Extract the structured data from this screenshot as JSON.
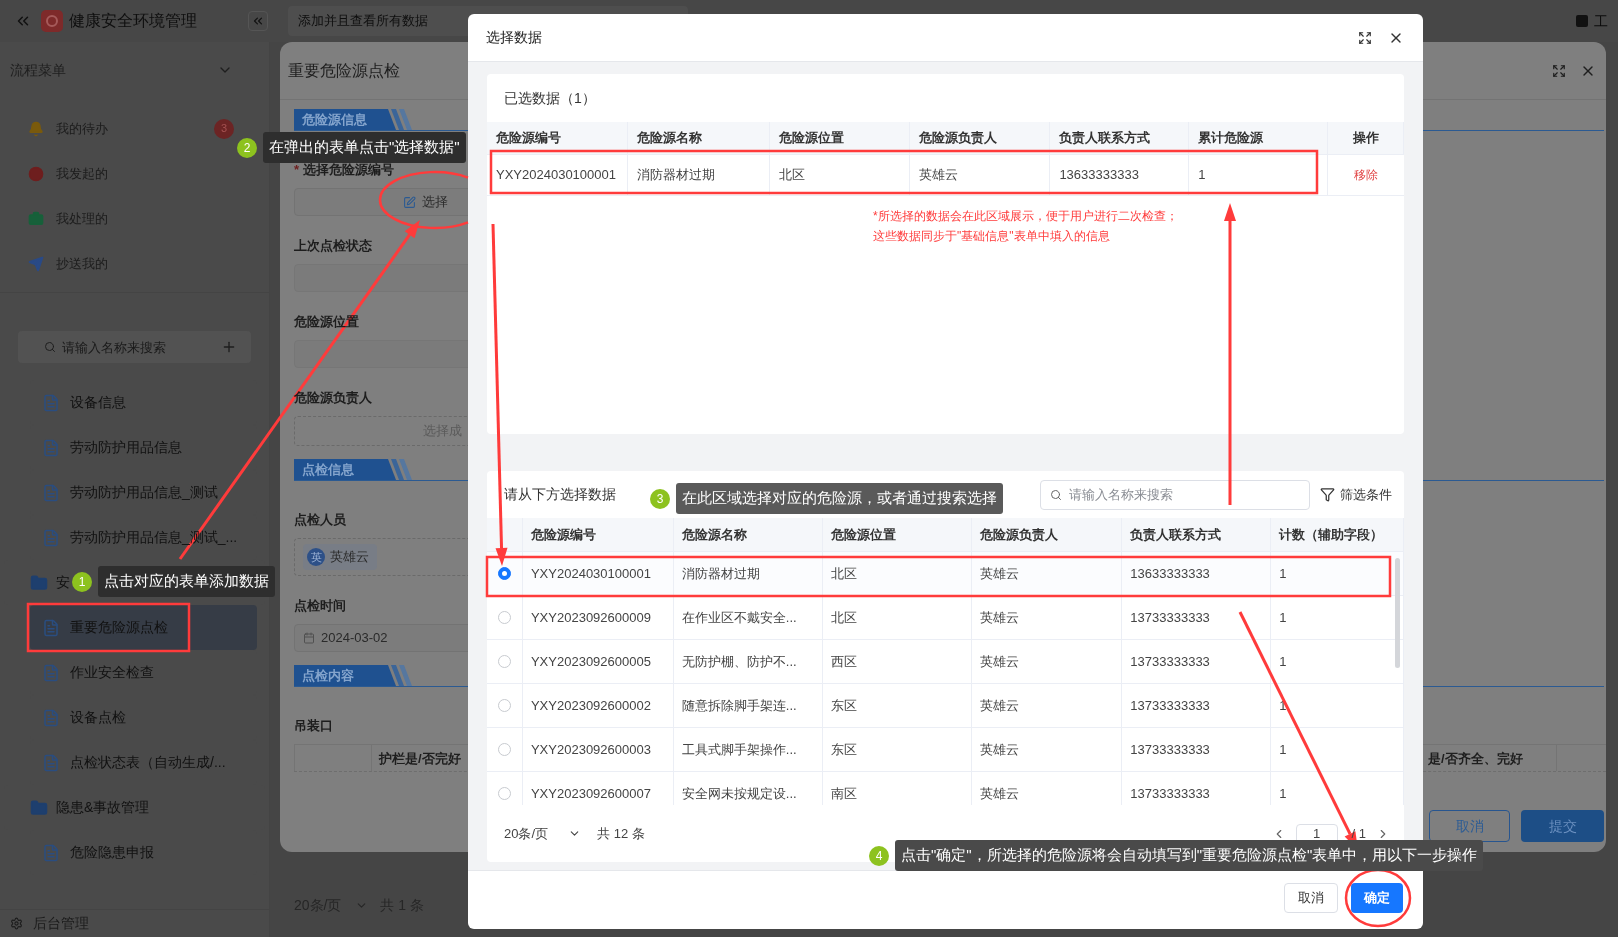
{
  "app": {
    "title": "健康安全环境管理",
    "tab": "添加并且查看所有数据",
    "top_right": "工"
  },
  "sidebar": {
    "section": "流程菜单",
    "quick_items": [
      {
        "label": "我的待办",
        "kind": "todo",
        "badge": "3"
      },
      {
        "label": "我发起的",
        "kind": "started"
      },
      {
        "label": "我处理的",
        "kind": "handled"
      },
      {
        "label": "抄送我的",
        "kind": "cc"
      }
    ],
    "search": {
      "placeholder": "请输入名称来搜索"
    },
    "tree": [
      {
        "label": "设备信息",
        "kind": "form",
        "selected": false
      },
      {
        "label": "劳动防护用品信息",
        "kind": "form",
        "selected": false
      },
      {
        "label": "劳动防护用品信息_测试",
        "kind": "form",
        "selected": false
      },
      {
        "label": "劳动防护用品信息_测试_...",
        "kind": "form",
        "selected": false
      },
      {
        "label": "安",
        "kind": "folder",
        "selected": false,
        "children": [
          {
            "label": "重要危险源点检",
            "kind": "form",
            "selected": true
          },
          {
            "label": "作业安全检查",
            "kind": "form",
            "selected": false
          },
          {
            "label": "设备点检",
            "kind": "form",
            "selected": false
          },
          {
            "label": "点检状态表（自动生成/...",
            "kind": "form",
            "selected": false
          }
        ]
      },
      {
        "label": "隐患&事故管理",
        "kind": "folder",
        "selected": false,
        "children": [
          {
            "label": "危险隐患申报",
            "kind": "form",
            "selected": false
          }
        ]
      }
    ],
    "footer": "后台管理"
  },
  "background_pagination": {
    "page_size": "20条/页",
    "total": "共 1 条"
  },
  "form_drawer": {
    "title": "重要危险源点检",
    "required_mark": "*",
    "sections": [
      {
        "title": "危险源信息",
        "fields": [
          {
            "label": "选择危险源编号",
            "required": true,
            "kind": "picker",
            "button": "选择"
          },
          {
            "label": "上次点检状态",
            "required": false,
            "kind": "input"
          },
          {
            "label": "危险源位置",
            "required": false,
            "kind": "input"
          },
          {
            "label": "危险源负责人",
            "required": false,
            "kind": "auto",
            "hint": "选择成"
          }
        ]
      },
      {
        "title": "点检信息",
        "fields": [
          {
            "label": "点检人员",
            "required": false,
            "kind": "user",
            "avatar": "英",
            "tag": "英雄云"
          },
          {
            "label": "点检时间",
            "required": false,
            "kind": "date",
            "value": "2024-03-02"
          }
        ]
      },
      {
        "title": "点检内容",
        "fields": [
          {
            "label": "吊装口",
            "required": false,
            "kind": "table",
            "columns": [
              "护栏是/否完好",
              "是/否齐全、完好"
            ]
          }
        ]
      }
    ],
    "buttons": {
      "cancel": "取消",
      "submit": "提交"
    }
  },
  "dialog": {
    "title": "选择数据",
    "selected_panel": {
      "title": "已选数据（1）",
      "columns": [
        "危险源编号",
        "危险源名称",
        "危险源位置",
        "危险源负责人",
        "负责人联系方式",
        "累计危险源",
        "操作"
      ],
      "rows": [
        {
          "cells": [
            "YXY2024030100001",
            "消防器材过期",
            "北区",
            "英雄云",
            "13633333333",
            "1"
          ],
          "action": "移除"
        }
      ]
    },
    "source_panel": {
      "title": "请从下方选择数据",
      "search": {
        "placeholder": "请输入名称来搜索"
      },
      "filter": "筛选条件",
      "columns": [
        "危险源编号",
        "危险源名称",
        "危险源位置",
        "危险源负责人",
        "负责人联系方式",
        "计数（辅助字段）"
      ],
      "rows": [
        {
          "selected": true,
          "cells": [
            "YXY2024030100001",
            "消防器材过期",
            "北区",
            "英雄云",
            "13633333333",
            "1"
          ]
        },
        {
          "selected": false,
          "cells": [
            "YXY2023092600009",
            "在作业区不戴安全...",
            "北区",
            "英雄云",
            "13733333333",
            "1"
          ]
        },
        {
          "selected": false,
          "cells": [
            "YXY2023092600005",
            "无防护棚、防护不...",
            "西区",
            "英雄云",
            "13733333333",
            "1"
          ]
        },
        {
          "selected": false,
          "cells": [
            "YXY2023092600002",
            "随意拆除脚手架连...",
            "东区",
            "英雄云",
            "13733333333",
            "1"
          ]
        },
        {
          "selected": false,
          "cells": [
            "YXY2023092600003",
            "工具式脚手架操作...",
            "东区",
            "英雄云",
            "13733333333",
            "1"
          ]
        },
        {
          "selected": false,
          "cells": [
            "YXY2023092600007",
            "安全网未按规定设...",
            "南区",
            "英雄云",
            "13733333333",
            "1"
          ]
        }
      ],
      "pagination": {
        "page_size": "20条/页",
        "total": "共 12 条",
        "page": "1",
        "pages": "/ 1"
      }
    },
    "buttons": {
      "cancel": "取消",
      "confirm": "确定"
    }
  },
  "annotations": {
    "note_lines": [
      "*所选择的数据会在此区域展示，便于用户进行二次检查；",
      "这些数据同步于\"基础信息\"表单中填入的信息"
    ],
    "callouts": [
      {
        "number": "1",
        "text": "点击对应的表单添加数据"
      },
      {
        "number": "2",
        "text": "在弹出的表单点击\"选择数据\""
      },
      {
        "number": "3",
        "text": "在此区域选择对应的危险源，或者通过搜索选择"
      },
      {
        "number": "4",
        "text": "点击\"确定\"，所选择的危险源将会自动填写到\"重要危险源点检\"表单中，用以下一步操作"
      }
    ]
  }
}
